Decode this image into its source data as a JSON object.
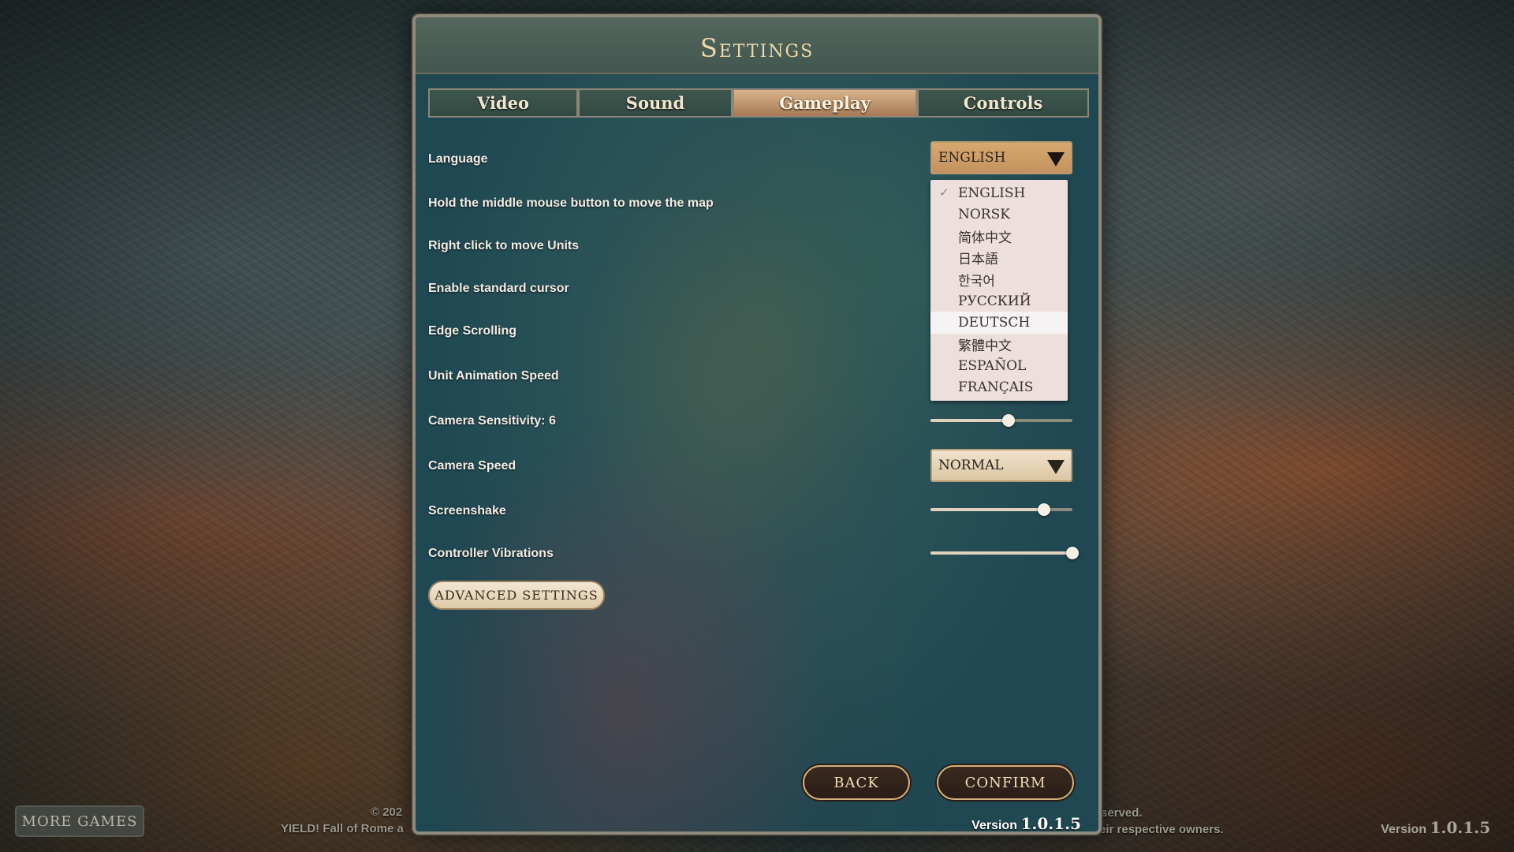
{
  "title": "Settings",
  "tabs": [
    {
      "label": "Video"
    },
    {
      "label": "Sound"
    },
    {
      "label": "Gameplay",
      "active": true
    },
    {
      "label": "Controls"
    }
  ],
  "settings": {
    "language": {
      "label": "Language",
      "value": "ENGLISH"
    },
    "middle_mouse": {
      "label": "Hold the middle mouse button to move the map"
    },
    "right_click": {
      "label": "Right click to move Units"
    },
    "standard_cursor": {
      "label": "Enable standard cursor"
    },
    "edge_scrolling": {
      "label": "Edge Scrolling"
    },
    "unit_animation_speed": {
      "label": "Unit Animation Speed"
    },
    "camera_sensitivity": {
      "label": "Camera Sensitivity: 6",
      "level": 0.55
    },
    "camera_speed": {
      "label": "Camera Speed",
      "value": "NORMAL"
    },
    "screenshake": {
      "label": "Screenshake",
      "level": 0.8
    },
    "controller_vibrations": {
      "label": "Controller Vibrations",
      "level": 1.0
    }
  },
  "language_menu": {
    "items": [
      "ENGLISH",
      "NORSK",
      "简体中文",
      "日本語",
      "한국어",
      "РУССКИЙ",
      "DEUTSCH",
      "繁體中文",
      "ESPAÑOL",
      "FRANÇAIS"
    ],
    "selected": "ENGLISH",
    "hovered": "DEUTSCH",
    "check_glyph": "✓"
  },
  "advanced_button": "ADVANCED SETTINGS",
  "back_button": "BACK",
  "confirm_button": "CONFIRM",
  "panel_version": {
    "label": "Version",
    "number": "1.0.1.5"
  },
  "more_games": "MORE GAMES",
  "footer": {
    "left_line1": "© 202",
    "left_line2": "YIELD! Fall of Rome a",
    "right_line1": "served.",
    "right_line2": "eir respective owners."
  },
  "corner_version": {
    "label": "Version",
    "number": "1.0.1.5"
  },
  "colors": {
    "accent": "#d8b48a",
    "title": "#f0d9a8",
    "toggle_on": "#6a9a4a"
  }
}
